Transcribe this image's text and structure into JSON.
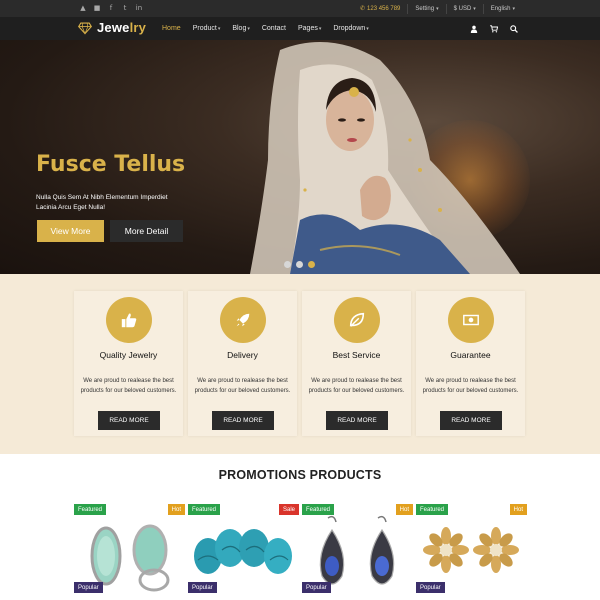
{
  "topbar": {
    "socials": [
      "social-icon-1",
      "social-icon-2",
      "facebook-icon",
      "twitter-icon",
      "linkedin-icon"
    ],
    "phone": "123 456 789",
    "setting": "Setting",
    "currency": "$ USD",
    "language": "English"
  },
  "nav": {
    "brand_prefix": "Jewe",
    "brand_suffix": "lry",
    "items": [
      {
        "label": "Home",
        "active": true
      },
      {
        "label": "Product",
        "dropdown": true
      },
      {
        "label": "Blog",
        "dropdown": true
      },
      {
        "label": "Contact"
      },
      {
        "label": "Pages",
        "dropdown": true
      },
      {
        "label": "Dropdown",
        "dropdown": true
      }
    ],
    "icons": [
      "user-icon",
      "cart-icon",
      "search-icon"
    ]
  },
  "hero": {
    "title": "Fusce Tellus",
    "subtitle": "Nulla Quis Sem At Nibh Elementum Imperdiet Lacinia Arcu Eget Nulla!",
    "primary_button": "View More",
    "secondary_button": "More Detail",
    "slides": 3,
    "active_slide": 3
  },
  "features": [
    {
      "icon": "thumbs-up-icon",
      "title": "Quality Jewelry",
      "text": "We are proud to realease the best products for our beloved customers.",
      "button": "READ MORE"
    },
    {
      "icon": "rocket-icon",
      "title": "Delivery",
      "text": "We are proud to realease the best products for our beloved customers.",
      "button": "READ MORE"
    },
    {
      "icon": "leaf-icon",
      "title": "Best Service",
      "text": "We are proud to realease the best products for our beloved customers.",
      "button": "READ MORE"
    },
    {
      "icon": "money-icon",
      "title": "Guarantee",
      "text": "We are proud to realease the best products for our beloved customers.",
      "button": "READ MORE"
    }
  ],
  "promotions": {
    "title": "PROMOTIONS PRODUCTS",
    "products": [
      {
        "badge_left": "Featured",
        "badge_right": "Hot",
        "badge_bottom": "Popular"
      },
      {
        "badge_left": "Featured",
        "badge_right": "Sale",
        "badge_bottom": "Popular"
      },
      {
        "badge_left": "Featured",
        "badge_right": "Hot",
        "badge_bottom": "Popular"
      },
      {
        "badge_left": "Featured",
        "badge_right": "Hot",
        "badge_bottom": "Popular"
      }
    ]
  },
  "colors": {
    "gold": "#d9b24a",
    "dark": "#1f1f1f",
    "cream": "#f5ead7",
    "featured": "#2aa24a",
    "hot": "#e2a01e",
    "sale": "#d9342b",
    "popular": "#3b2f6b"
  }
}
